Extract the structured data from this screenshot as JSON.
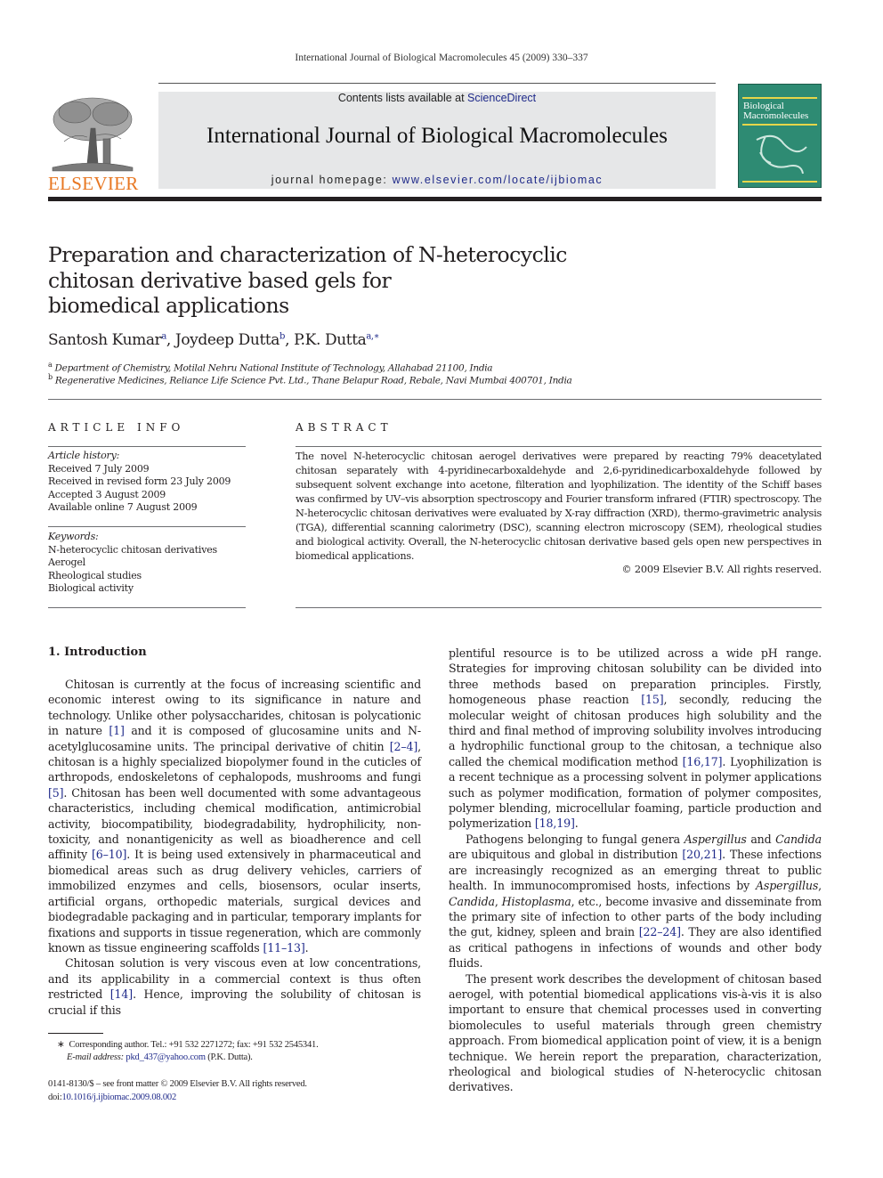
{
  "running_head": "International Journal of Biological Macromolecules 45 (2009) 330–337",
  "banner": {
    "contents_prefix": "Contents lists available at ",
    "contents_link": "ScienceDirect",
    "journal_name": "International Journal of Biological Macromolecules",
    "homepage_prefix": "journal homepage: ",
    "homepage_link": "www.elsevier.com/locate/ijbiomac",
    "publisher_logo_text": "ELSEVIER",
    "cover_title_line1": "Biological",
    "cover_title_line2": "Macromolecules"
  },
  "colors": {
    "link": "#1f2a8a",
    "elsevier_orange": "#e87722",
    "cover_green": "#2e8b73",
    "banner_gray": "#e6e7e8"
  },
  "article": {
    "title": "Preparation and characterization of N-heterocyclic chitosan derivative based gels for biomedical applications",
    "title_lines": [
      "Preparation and characterization of N-heterocyclic",
      "chitosan derivative based gels for",
      "biomedical applications"
    ],
    "authors": [
      {
        "name": "Santosh Kumar",
        "sup": "a"
      },
      {
        "name": "Joydeep Dutta",
        "sup": "b"
      },
      {
        "name": "P.K. Dutta",
        "sup": "a,∗"
      }
    ],
    "affiliations": [
      {
        "mark": "a",
        "text": "Department of Chemistry, Motilal Nehru National Institute of Technology, Allahabad 21100, India"
      },
      {
        "mark": "b",
        "text": "Regenerative Medicines, Reliance Life Science Pvt. Ltd., Thane Belapur Road, Rebale, Navi Mumbai 400701, India"
      }
    ]
  },
  "article_info": {
    "heading": "ARTICLE INFO",
    "history_label": "Article history:",
    "history": [
      "Received 7 July 2009",
      "Received in revised form 23 July 2009",
      "Accepted 3 August 2009",
      "Available online 7 August 2009"
    ],
    "keywords_label": "Keywords:",
    "keywords": [
      "N-heterocyclic chitosan derivatives",
      "Aerogel",
      "Rheological studies",
      "Biological activity"
    ]
  },
  "abstract": {
    "heading": "ABSTRACT",
    "text": "The novel N-heterocyclic chitosan aerogel derivatives were prepared by reacting 79% deacetylated chitosan separately with 4-pyridinecarboxaldehyde and 2,6-pyridinedicarboxaldehyde followed by subsequent solvent exchange into acetone, filteration and lyophilization. The identity of the Schiff bases was confirmed by UV–vis absorption spectroscopy and Fourier transform infrared (FTIR) spectroscopy. The N-heterocyclic chitosan derivatives were evaluated by X-ray diffraction (XRD), thermo-gravimetric analysis (TGA), differential scanning calorimetry (DSC), scanning electron microscopy (SEM), rheological studies and biological activity. Overall, the N-heterocyclic chitosan derivative based gels open new perspectives in biomedical applications.",
    "copyright": "© 2009 Elsevier B.V. All rights reserved."
  },
  "introduction": {
    "heading": "1.  Introduction",
    "left_column": [
      [
        {
          "t": "Chitosan is currently at the focus of increasing scientific and economic interest owing to its significance in nature and technology. Unlike other polysaccharides, chitosan is polycationic in nature "
        },
        {
          "ref": "[1]"
        },
        {
          "t": " and it is composed of glucosamine units and N-acetylglucosamine units. The principal derivative of chitin "
        },
        {
          "ref": "[2–4]"
        },
        {
          "t": ", chitosan is a highly specialized biopolymer found in the cuticles of arthropods, endoskeletons of cephalopods, mushrooms and fungi "
        },
        {
          "ref": "[5]"
        },
        {
          "t": ". Chitosan has been well documented with some advantageous characteristics, including chemical modification, antimicrobial activity, biocompatibility, biodegradability, hydrophilicity, non-toxicity, and nonantigenicity as well as bioadherence and cell affinity "
        },
        {
          "ref": "[6–10]"
        },
        {
          "t": ". It is being used extensively in pharmaceutical and biomedical areas such as drug delivery vehicles, carriers of immobilized enzymes and cells, biosensors, ocular inserts, artificial organs, orthopedic materials, surgical devices and biodegradable packaging and in particular, temporary implants for fixations and supports in tissue regeneration, which are commonly known as tissue engineering scaffolds "
        },
        {
          "ref": "[11–13]"
        },
        {
          "t": "."
        }
      ],
      [
        {
          "t": "Chitosan solution is very viscous even at low concentrations, and its applicability in a commercial context is thus often restricted "
        },
        {
          "ref": "[14]"
        },
        {
          "t": ". Hence, improving the solubility of chitosan is crucial if this"
        }
      ]
    ],
    "right_column": [
      [
        {
          "t": "plentiful resource is to be utilized across a wide pH range. Strategies for improving chitosan solubility can be divided into three methods based on preparation principles. Firstly, homogeneous phase reaction "
        },
        {
          "ref": "[15]"
        },
        {
          "t": ", secondly, reducing the molecular weight of chitosan produces high solubility and the third and final method of improving solubility involves introducing a hydrophilic functional group to the chitosan, a technique also called the chemical modification method "
        },
        {
          "ref": "[16,17]"
        },
        {
          "t": ". Lyophilization is a recent technique as a processing solvent in polymer applications such as polymer modification, formation of polymer composites, polymer blending, microcellular foaming, particle production and polymerization "
        },
        {
          "ref": "[18,19]"
        },
        {
          "t": "."
        }
      ],
      [
        {
          "t": "Pathogens belonging to fungal genera "
        },
        {
          "i": "Aspergillus"
        },
        {
          "t": " and "
        },
        {
          "i": "Candida"
        },
        {
          "t": " are ubiquitous and global in distribution "
        },
        {
          "ref": "[20,21]"
        },
        {
          "t": ". These infections are increasingly recognized as an emerging threat to public health. In immunocompromised hosts, infections by "
        },
        {
          "i": "Aspergillus"
        },
        {
          "t": ", "
        },
        {
          "i": "Candida"
        },
        {
          "t": ", "
        },
        {
          "i": "Histoplasma"
        },
        {
          "t": ", etc., become invasive and disseminate from the primary site of infection to other parts of the body including the gut, kidney, spleen and brain "
        },
        {
          "ref": "[22–24]"
        },
        {
          "t": ". They are also identified as critical pathogens in infections of wounds and other body fluids."
        }
      ],
      [
        {
          "t": "The present work describes the development of chitosan based aerogel, with potential biomedical applications vis-à-vis it is also important to ensure that chemical processes used in converting biomolecules to useful materials through green chemistry approach. From biomedical application point of view, it is a benign technique. We herein report the preparation, characterization, rheological and biological studies of N-heterocyclic chitosan derivatives."
        }
      ]
    ]
  },
  "footnotes": {
    "corresponding_mark": "∗",
    "corresponding_text": "Corresponding author. Tel.: +91 532 2271272; fax: +91 532 2545341.",
    "email_label": "E-mail address:",
    "email": "pkd_437@yahoo.com",
    "email_suffix": " (P.K. Dutta).",
    "front_matter": "0141-8130/$ – see front matter © 2009 Elsevier B.V. All rights reserved.",
    "doi_prefix": "doi:",
    "doi": "10.1016/j.ijbiomac.2009.08.002"
  }
}
